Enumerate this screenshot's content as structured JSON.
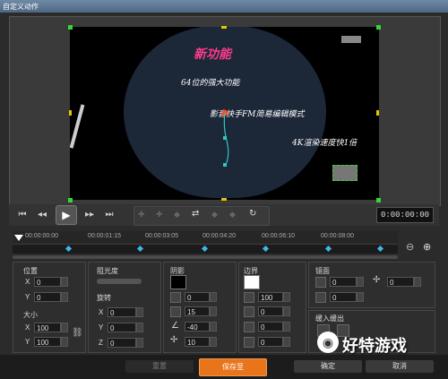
{
  "window": {
    "title": "自定义动作"
  },
  "video": {
    "line1": "新功能",
    "line2": "64位的强大功能",
    "line3": "影音快手FM简易编辑模式",
    "line4": "4K渲染速度快1倍"
  },
  "timecode": "0:00:00:00",
  "ruler_ticks": [
    "00:00:00:00",
    "00:00:01:15",
    "00:00:03:05",
    "00:00:04:20",
    "00:00:06:10",
    "00:00:08:00"
  ],
  "position": {
    "title": "位置",
    "x_label": "X",
    "x_value": "0",
    "y_label": "Y",
    "y_value": "0"
  },
  "size": {
    "title": "大小",
    "x_label": "X",
    "x_value": "100",
    "y_label": "Y",
    "y_value": "100"
  },
  "opacity": {
    "title": "阻光度"
  },
  "rotation": {
    "title": "旋转",
    "x_label": "X",
    "x_value": "0",
    "y_label": "Y",
    "y_value": "0",
    "z_label": "Z",
    "z_value": "0"
  },
  "shadow": {
    "title": "阴影",
    "v1": "0",
    "v2": "15",
    "v3": "-40",
    "v4": "10"
  },
  "border": {
    "title": "边界",
    "v1": "0",
    "v2": "100",
    "v3": "0",
    "v4": "0",
    "v5": "0"
  },
  "mirror": {
    "title": "镜面",
    "v1": "0",
    "v2": "0",
    "v3": "0"
  },
  "ease": {
    "title": "缓入缓出"
  },
  "buttons": {
    "reset": "重置",
    "save_as": "保存至",
    "ok": "确定",
    "cancel": "取消"
  },
  "watermark": {
    "text": "好特游戏"
  },
  "colors": {
    "accent_orange": "#e8741c",
    "keyframe": "#3fb6e8",
    "video_text_pink": "#ff3c8c"
  }
}
